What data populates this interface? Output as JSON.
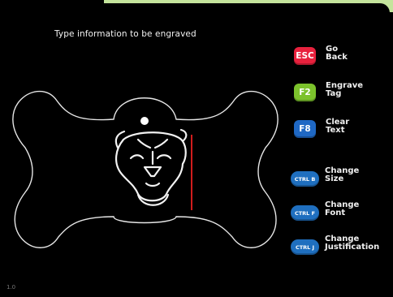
{
  "header": {
    "title": "Type information to be engraved"
  },
  "controls": [
    {
      "key": "ESC",
      "label": "Go\nBack",
      "color": "#e8213d"
    },
    {
      "key": "F2",
      "label": "Engrave\nTag",
      "color": "#7cc22c"
    },
    {
      "key": "F8",
      "label": "Clear\nText",
      "color": "#1f68c4"
    },
    {
      "key": "CTRL B",
      "label": "Change\nSize",
      "color": "#1f6fbf"
    },
    {
      "key": "CTRL F",
      "label": "Change\nFont",
      "color": "#1f6fbf"
    },
    {
      "key": "CTRL J",
      "label": "Change\nJustification",
      "color": "#1f6fbf"
    }
  ],
  "footer": {
    "corner": "1.0"
  },
  "icons": {
    "tag_graphic": "lion-head-icon",
    "cursor": "text-cursor"
  }
}
